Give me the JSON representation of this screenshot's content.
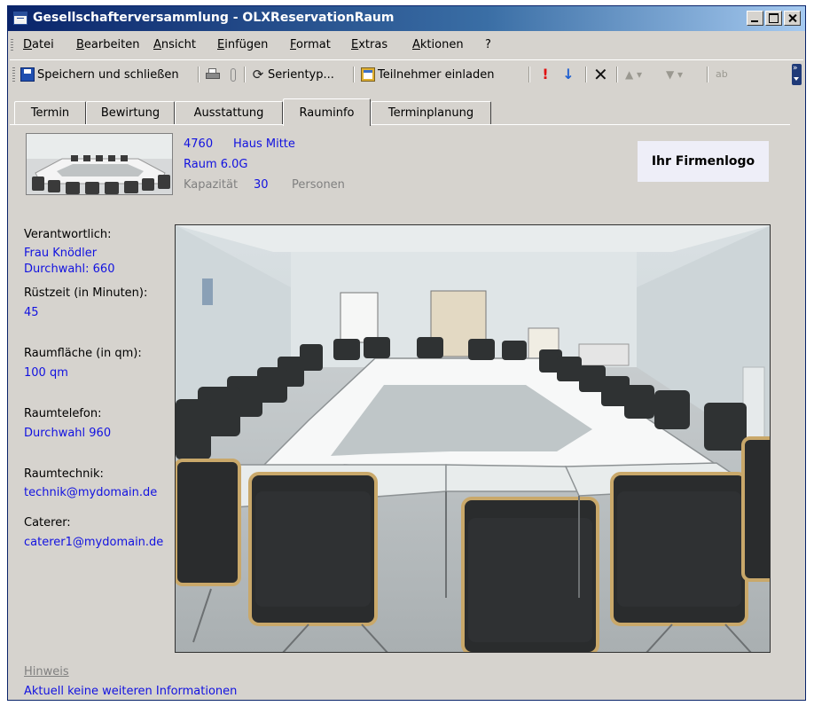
{
  "window": {
    "title": "Gesellschafterversammlung - OLXReservationRaum"
  },
  "menu": [
    "Datei",
    "Bearbeiten",
    "Ansicht",
    "Einfügen",
    "Format",
    "Extras",
    "Aktionen",
    "?"
  ],
  "toolbar": {
    "save_close": "Speichern und schließen",
    "recurrence": "Serientyp...",
    "invite": "Teilnehmer einladen"
  },
  "tabs": [
    "Termin",
    "Bewirtung",
    "Ausstattung",
    "Rauminfo",
    "Terminplanung"
  ],
  "active_tab": "Rauminfo",
  "room": {
    "number": "4760",
    "building": "Haus Mitte",
    "name": "Raum 6.0G",
    "capacity_label": "Kapazität",
    "capacity": "30",
    "capacity_unit": "Personen"
  },
  "logo_text": "Ihr Firmenlogo",
  "info": {
    "responsible_label": "Verantwortlich:",
    "responsible_name": "Frau Knödler",
    "responsible_phone": "Durchwahl: 660",
    "setup_label": "Rüstzeit (in Minuten):",
    "setup_value": "45",
    "area_label": "Raumfläche (in qm):",
    "area_value": "100 qm",
    "phone_label": "Raumtelefon:",
    "phone_value": "Durchwahl 960",
    "tech_label": "Raumtechnik:",
    "tech_value": "technik@mydomain.de",
    "caterer_label": "Caterer:",
    "caterer_value": "caterer1@mydomain.de"
  },
  "notice": {
    "label": "Hinweis",
    "text": "Aktuell keine weiteren Informationen"
  },
  "icons": [
    "save-icon",
    "print-icon",
    "paperclip-icon",
    "recurrence-icon",
    "invite-attendees-icon",
    "high-importance-icon",
    "low-importance-icon",
    "delete-icon",
    "previous-item-icon",
    "next-item-icon",
    "spelling-icon"
  ]
}
